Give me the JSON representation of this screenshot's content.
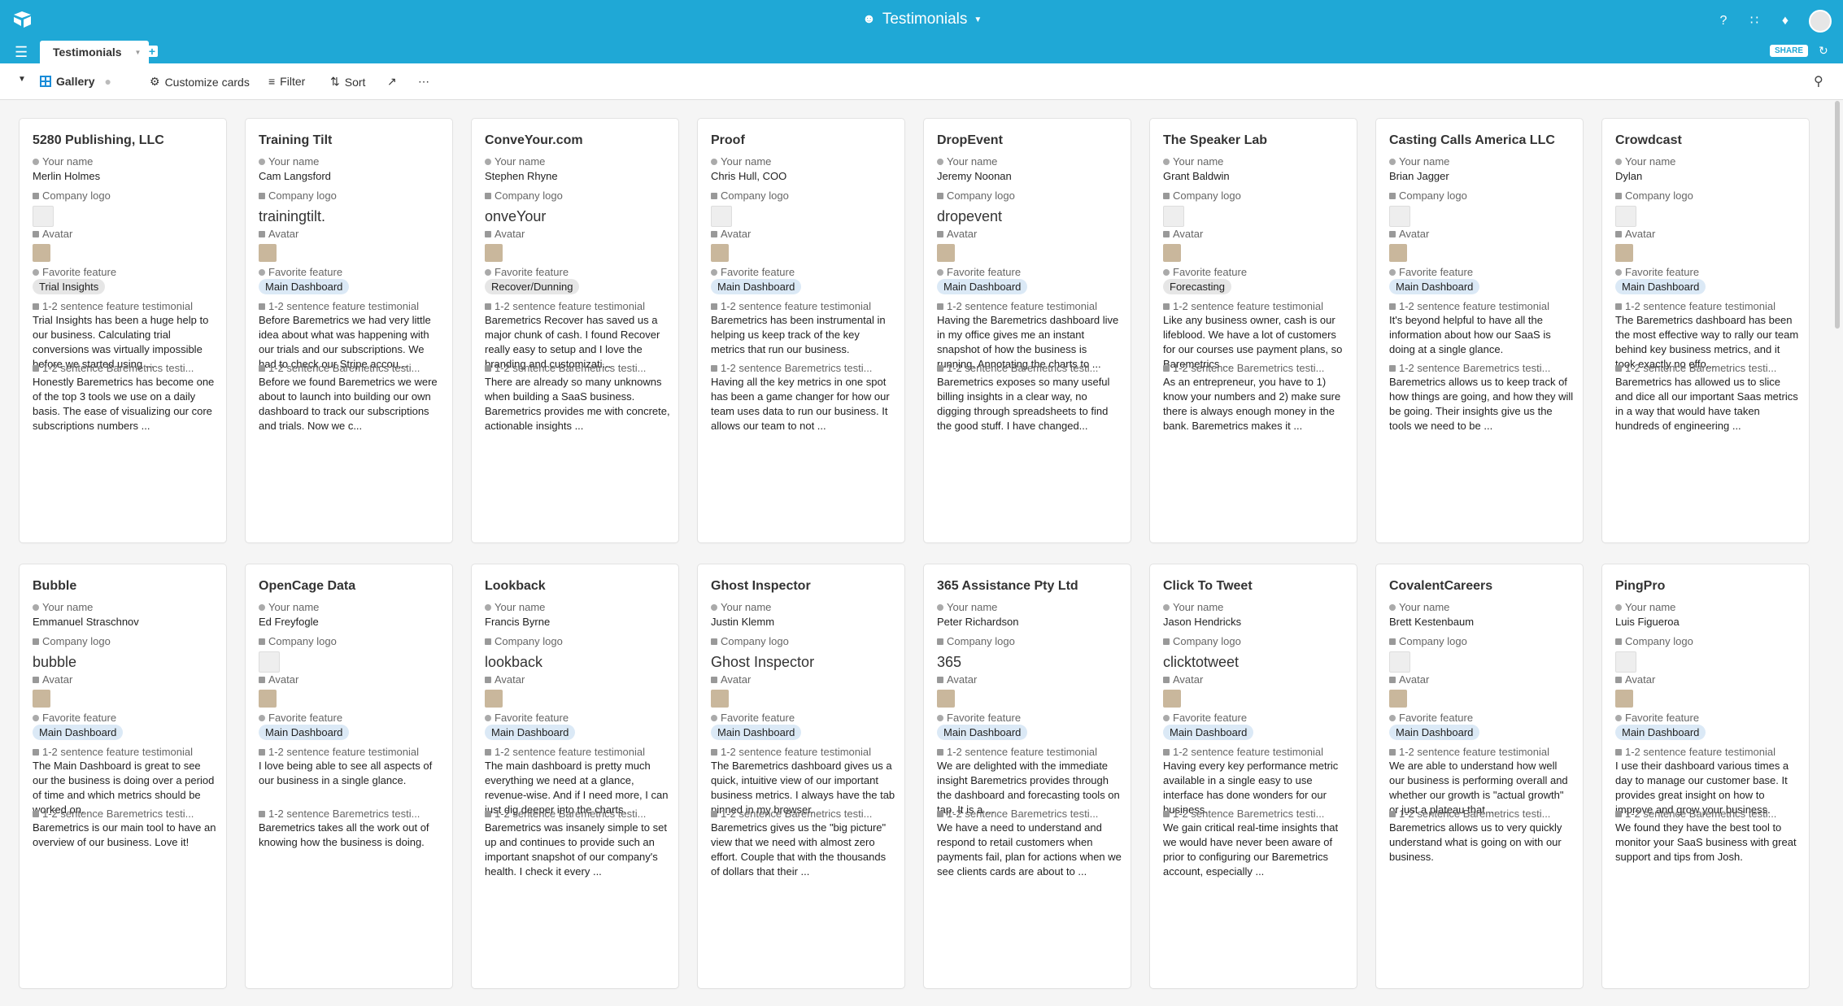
{
  "app": {
    "base_title": "Testimonials",
    "tab_label": "Testimonials",
    "share_label": "SHARE"
  },
  "toolbar": {
    "view_name": "Gallery",
    "customize_label": "Customize cards",
    "filter_label": "Filter",
    "sort_label": "Sort"
  },
  "field_labels": {
    "your_name": "Your name",
    "company_logo": "Company logo",
    "avatar": "Avatar",
    "favorite_feature": "Favorite feature",
    "feature_testimonial": "1-2 sentence feature testimonial",
    "baremetrics_testimonial": "1-2 sentence Baremetrics testi..."
  },
  "cards": [
    {
      "title": "5280 Publishing, LLC",
      "name": "Merlin Holmes",
      "logo_text": "",
      "feature": "Trial Insights",
      "feature_testimonial": "Trial Insights has been a huge help to our business. Calculating trial conversions was virtually impossible before we started using ...",
      "baremetrics_testimonial": "Honestly Baremetrics has become one of the top 3 tools we use on a daily basis. The ease of visualizing our core subscriptions numbers ..."
    },
    {
      "title": "Training Tilt",
      "name": "Cam Langsford",
      "logo_text": "trainingtilt.",
      "feature": "Main Dashboard",
      "feature_testimonial": "Before Baremetrics we had very little idea about what was happening with our trials and our subscriptions. We had to check our Stripe accou...",
      "baremetrics_testimonial": "Before we found Baremetrics we were about to launch into building our own dashboard to track our subscriptions and trials. Now we c..."
    },
    {
      "title": "ConveYour.com",
      "name": "Stephen Rhyne",
      "logo_text": "onveYour",
      "feature": "Recover/Dunning",
      "feature_testimonial": "Baremetrics Recover has saved us a major chunk of cash. I found Recover really easy to setup and I love the branding and customizati...",
      "baremetrics_testimonial": "There are already so many unknowns when building a SaaS business. Baremetrics provides me with concrete, actionable insights ..."
    },
    {
      "title": "Proof",
      "name": "Chris Hull, COO",
      "logo_text": "",
      "feature": "Main Dashboard",
      "feature_testimonial": "Baremetrics has been instrumental in helping us keep track of the key metrics that run our business.",
      "baremetrics_testimonial": "Having all the key metrics in one spot has been a game changer for how our team uses data to run our business. It allows our team to not ..."
    },
    {
      "title": "DropEvent",
      "name": "Jeremy Noonan",
      "logo_text": "dropevent",
      "feature": "Main Dashboard",
      "feature_testimonial": "Having the Baremetrics dashboard live in my office gives me an instant snapshot of how the business is running. Annotating the charts to ...",
      "baremetrics_testimonial": "Baremetrics exposes so many useful billing insights in a clear way, no digging through spreadsheets to find the good stuff. I have changed..."
    },
    {
      "title": "The Speaker Lab",
      "name": "Grant Baldwin",
      "logo_text": "",
      "feature": "Forecasting",
      "feature_testimonial": "Like any business owner, cash is our lifeblood. We have a lot of customers for our courses use payment plans, so Baremetrics ...",
      "baremetrics_testimonial": "As an entrepreneur, you have to 1) know your numbers and 2) make sure there is always enough money in the bank. Baremetrics makes it ..."
    },
    {
      "title": "Casting Calls America LLC",
      "name": "Brian Jagger",
      "logo_text": "",
      "feature": "Main Dashboard",
      "feature_testimonial": "It's beyond helpful to have all the information about how our SaaS is doing at a single glance.",
      "baremetrics_testimonial": "Baremetrics allows us to keep track of how things are going, and how they will be going. Their insights give us the tools we need to be ..."
    },
    {
      "title": "Crowdcast",
      "name": "Dylan",
      "logo_text": "",
      "feature": "Main Dashboard",
      "feature_testimonial": "The Baremetrics dashboard has been the most effective way to rally our team behind key business metrics, and it took exactly no effo...",
      "baremetrics_testimonial": "Baremetrics has allowed us to slice and dice all our important Saas metrics in a way that would have taken hundreds of engineering ..."
    },
    {
      "title": "Bubble",
      "name": "Emmanuel Straschnov",
      "logo_text": "bubble",
      "feature": "Main Dashboard",
      "feature_testimonial": "The Main Dashboard is great to see our the business is doing over a period of time and which metrics should be worked on.",
      "baremetrics_testimonial": "Baremetrics is our main tool to have an overview of our business. Love it!"
    },
    {
      "title": "OpenCage Data",
      "name": "Ed Freyfogle",
      "logo_text": "",
      "feature": "Main Dashboard",
      "feature_testimonial": "I love being able to see all aspects of our business in a single glance.",
      "baremetrics_testimonial": "Baremetrics takes all the work out of knowing how the business is doing."
    },
    {
      "title": "Lookback",
      "name": "Francis Byrne",
      "logo_text": "lookback",
      "feature": "Main Dashboard",
      "feature_testimonial": "The main dashboard is pretty much everything we need at a glance, revenue-wise. And if I need more, I can just dig deeper into the charts.",
      "baremetrics_testimonial": "Baremetrics was insanely simple to set up and continues to provide such an important snapshot of our company's health. I check it every ..."
    },
    {
      "title": "Ghost Inspector",
      "name": "Justin Klemm",
      "logo_text": "Ghost Inspector",
      "feature": "Main Dashboard",
      "feature_testimonial": "The Baremetrics dashboard gives us a quick, intuitive view of our important business metrics. I always have the tab pinned in my browser.",
      "baremetrics_testimonial": "Baremetrics gives us the \"big picture\" view that we need with almost zero effort. Couple that with the thousands of dollars that their ..."
    },
    {
      "title": "365 Assistance Pty Ltd",
      "name": "Peter Richardson",
      "logo_text": "365",
      "feature": "Main Dashboard",
      "feature_testimonial": "We are delighted with the immediate insight Baremetrics provides through the dashboard and forecasting tools on tap. It is a ...",
      "baremetrics_testimonial": "We have a need to understand and respond to retail customers when payments fail, plan for actions when we see clients cards are about to ..."
    },
    {
      "title": "Click To Tweet",
      "name": "Jason Hendricks",
      "logo_text": "clicktotweet",
      "feature": "Main Dashboard",
      "feature_testimonial": "Having every key performance metric available in a single easy to use interface has done wonders for our business.",
      "baremetrics_testimonial": "We gain critical real-time insights that we would have never been aware of prior to configuring our Baremetrics account, especially ..."
    },
    {
      "title": "CovalentCareers",
      "name": "Brett Kestenbaum",
      "logo_text": "",
      "feature": "Main Dashboard",
      "feature_testimonial": "We are able to understand how well our business is performing overall and whether our growth is \"actual growth\" or just a plateau that ...",
      "baremetrics_testimonial": "Baremetrics allows us to very quickly understand what is going on with our business."
    },
    {
      "title": "PingPro",
      "name": "Luis Figueroa",
      "logo_text": "",
      "feature": "Main Dashboard",
      "feature_testimonial": "I use their dashboard various times a day to manage our customer base. It provides great insight on how to improve and grow your business.",
      "baremetrics_testimonial": "We found they have the best tool to monitor your SaaS business with great support and tips from Josh."
    }
  ]
}
